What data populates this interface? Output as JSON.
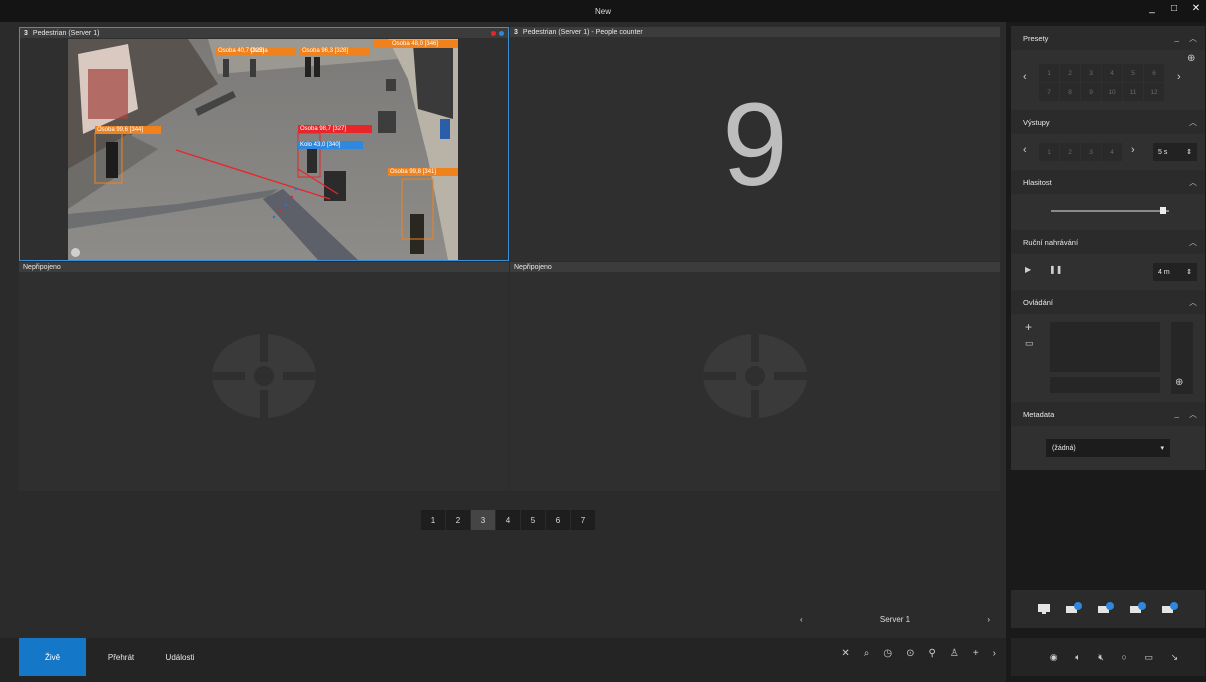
{
  "window": {
    "title": "New",
    "controls": [
      "_",
      "□",
      "✕"
    ]
  },
  "tiles": [
    {
      "num": "3",
      "label": "Pedestrian (Server 1)"
    },
    {
      "num": "3",
      "label": "Pedestrian (Server 1) - People counter",
      "count": "9"
    },
    {
      "num": "",
      "label": "Nepřipojeno"
    },
    {
      "num": "",
      "label": "Nepřipojeno"
    }
  ],
  "detections": [
    {
      "label": "Osoba  99,6  [344]",
      "color": "#f0821e"
    },
    {
      "label": "Osoba  98,7  [327]",
      "color": "#e8262a"
    },
    {
      "label": "Kolo  43,0  [340]",
      "color": "#2f88e0"
    },
    {
      "label": "Osoba  99,8  [341]",
      "color": "#f0821e"
    },
    {
      "label": "Osoba  96,3  [328]",
      "color": "#f0821e"
    },
    {
      "label": "Osoba  40,7  [325]",
      "color": "#f0821e"
    },
    {
      "label": "Osoba  48,0  [346]",
      "color": "#f0821e"
    },
    {
      "label": "Osoba",
      "color": "#f0821e"
    }
  ],
  "pager": {
    "pages": [
      "1",
      "2",
      "3",
      "4",
      "5",
      "6",
      "7"
    ],
    "active": "3"
  },
  "server": {
    "name": "Server 1"
  },
  "nav": {
    "live": "Živě",
    "playback": "Přehrát",
    "events": "Události"
  },
  "right_panel": {
    "presets": {
      "title": "Presety",
      "items": [
        "1",
        "2",
        "3",
        "4",
        "5",
        "6",
        "7",
        "8",
        "9",
        "10",
        "11",
        "12"
      ]
    },
    "outputs": {
      "title": "Výstupy",
      "items": [
        "1",
        "2",
        "3",
        "4"
      ],
      "interval": "5 s"
    },
    "volume": {
      "title": "Hlasitost",
      "level": 0.95
    },
    "manual_recording": {
      "title": "Ruční nahrávání",
      "duration": "4 m"
    },
    "control": {
      "title": "Ovládání"
    },
    "metadata": {
      "title": "Metadata",
      "selected": "(žádná)"
    }
  },
  "colors": {
    "accent": "#1577c7",
    "selection_border": "#3a8fd6",
    "detection_person": "#f0821e",
    "detection_alert": "#e8262a",
    "detection_bike": "#2f88e0"
  }
}
